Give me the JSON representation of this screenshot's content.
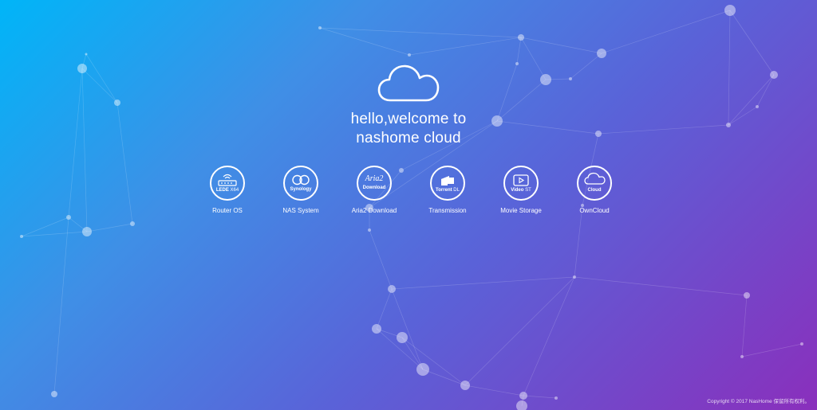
{
  "hero": {
    "headline_line1": "hello,welcome to",
    "headline_line2": "nashome cloud"
  },
  "apps": [
    {
      "label": "Router OS",
      "icon_name": "router-icon",
      "icon_text_1": "LEDE",
      "icon_text_2": "X64"
    },
    {
      "label": "NAS System",
      "icon_name": "synology-icon",
      "icon_text_1": "Synology"
    },
    {
      "label": "Aria2 Download",
      "icon_name": "aria2-icon",
      "icon_text_1": "Aria2",
      "icon_text_2": "Download"
    },
    {
      "label": "Transmission",
      "icon_name": "torrent-icon",
      "icon_text_1": "Torrent",
      "icon_text_2": "DL"
    },
    {
      "label": "Movie Storage",
      "icon_name": "video-icon",
      "icon_text_1": "Video",
      "icon_text_2": "ST"
    },
    {
      "label": "OwnCloud",
      "icon_name": "owncloud-icon",
      "icon_text_1": "Cloud"
    }
  ],
  "footer": {
    "copyright": "Copyright © 2017 NasHome 保留所有权利。"
  },
  "colors": {
    "gradient_start": "#00b5f8",
    "gradient_end": "#8a2fbc"
  }
}
